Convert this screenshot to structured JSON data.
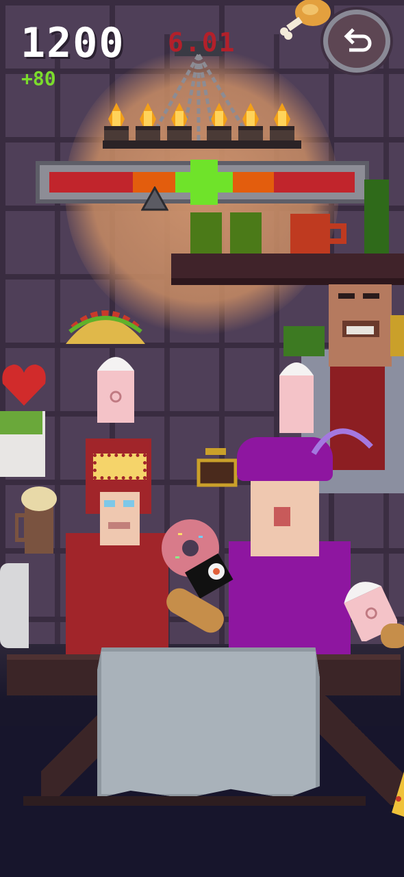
{
  "hud": {
    "score": "1200",
    "bonus": "+80",
    "timer": "6.01"
  },
  "colors": {
    "score_text": "#ffffff",
    "bonus_text": "#7bdc2c",
    "timer_text": "#b3202a",
    "meter_red": "#c1252c",
    "meter_orange": "#e35d0d",
    "meter_green": "#6fe32a"
  },
  "meter": {
    "zones": [
      "red",
      "orange",
      "green",
      "orange",
      "red"
    ],
    "pointer_fraction": 0.36
  },
  "icons": {
    "back": "undo-arrow-icon",
    "drumstick": "drumstick-icon"
  }
}
